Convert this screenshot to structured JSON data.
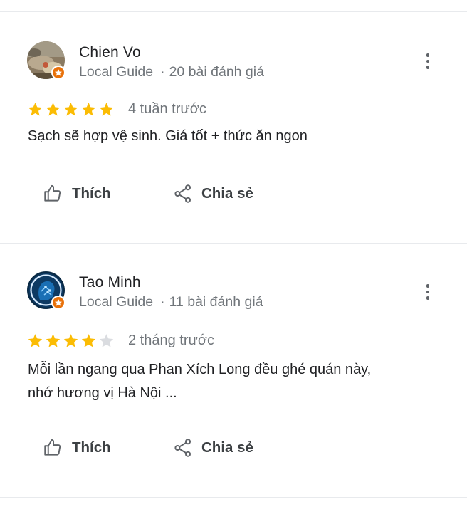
{
  "reviews": [
    {
      "name": "Chien Vo",
      "badge": "Local Guide",
      "review_count": "20 bài đánh giá",
      "rating": 5,
      "time": "4 tuần trước",
      "text": "Sạch sẽ hợp vệ sinh. Giá tốt + thức ăn ngon",
      "like_label": "Thích",
      "share_label": "Chia sẻ"
    },
    {
      "name": "Tao Minh",
      "badge": "Local Guide",
      "review_count": "11 bài đánh giá",
      "rating": 4,
      "time": "2 tháng trước",
      "text": "Mỗi lần ngang qua Phan Xích Long đều ghé quán này,",
      "text_line2": "nhớ hương vị Hà Nội ...",
      "like_label": "Thích",
      "share_label": "Chia sẻ"
    }
  ],
  "icons": {
    "more": "more-vert-icon",
    "like": "thumb-up-icon",
    "share": "share-icon",
    "star": "star-icon",
    "guide_badge": "local-guide-star-icon"
  },
  "colors": {
    "star_filled": "#fbbc04",
    "star_empty": "#dadce0",
    "guide_badge": "#e8710a",
    "secondary_text": "#70757a"
  }
}
